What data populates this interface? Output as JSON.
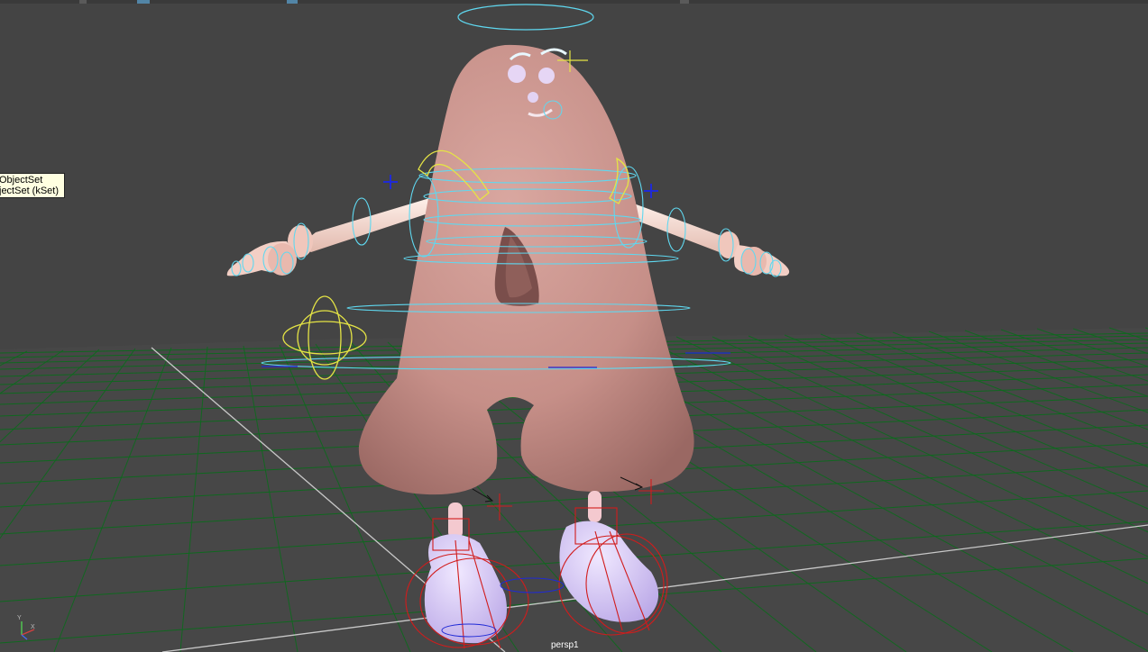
{
  "viewport": {
    "camera_name": "persp1",
    "background": "#444444",
    "grid_color": "#0f6a1f",
    "axis_color": "#c8c8c8"
  },
  "tooltip": {
    "line1": "ObjectSet",
    "line2": "jectSet (kSet)"
  },
  "character": {
    "body_color": "#c8938d",
    "arm_color": "#f6d8cf",
    "shoe_color": "#cdbdf0",
    "control_colors": {
      "cyan": "#5fd8f0",
      "yellow": "#e5e445",
      "red": "#d11c1c",
      "blue": "#1f2ad6"
    }
  },
  "axis_gizmo": {
    "x_label": "X",
    "y_label": "Y"
  }
}
